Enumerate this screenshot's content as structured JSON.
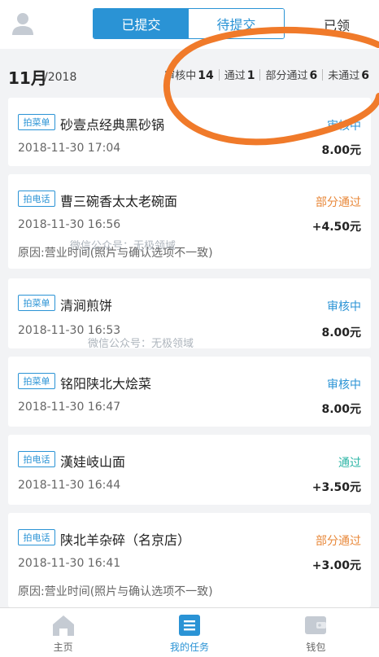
{
  "header": {
    "tabs": [
      {
        "label": "已提交",
        "active": true
      },
      {
        "label": "待提交",
        "active": false
      }
    ],
    "claimed_label": "已领"
  },
  "period": {
    "month": "11月",
    "year": "/2018"
  },
  "stats": [
    {
      "label": "审核中",
      "count": "14"
    },
    {
      "label": "通过",
      "count": "1"
    },
    {
      "label": "部分通过",
      "count": "6"
    },
    {
      "label": "未通过",
      "count": "6"
    }
  ],
  "tasks": [
    {
      "tag": "拍菜单",
      "title": "砂壹点经典黑砂锅",
      "status": "审核中",
      "time": "2018-11-30 17:04",
      "amount": "8.00元"
    },
    {
      "tag": "拍电话",
      "title": "曹三碗香太太老碗面",
      "status": "部分通过",
      "time": "2018-11-30 16:56",
      "amount": "+4.50元",
      "reason": "原因:营业时间(照片与确认选项不一致)"
    },
    {
      "tag": "拍菜单",
      "title": "清涧煎饼",
      "status": "审核中",
      "time": "2018-11-30 16:53",
      "amount": "8.00元"
    },
    {
      "tag": "拍菜单",
      "title": "铭阳陕北大烩菜",
      "status": "审核中",
      "time": "2018-11-30 16:47",
      "amount": "8.00元"
    },
    {
      "tag": "拍电话",
      "title": "漢娃岐山面",
      "status": "通过",
      "time": "2018-11-30 16:44",
      "amount": "+3.50元"
    },
    {
      "tag": "拍电话",
      "title": "陕北羊杂碎（名京店）",
      "status": "部分通过",
      "time": "2018-11-30 16:41",
      "amount": "+3.00元",
      "reason": "原因:营业时间(照片与确认选项不一致)"
    }
  ],
  "watermark": "微信公众号：无极领域",
  "nav": [
    {
      "label": "主页",
      "icon": "home-icon"
    },
    {
      "label": "我的任务",
      "icon": "task-list-icon"
    },
    {
      "label": "钱包",
      "icon": "wallet-icon"
    }
  ],
  "colors": {
    "accent": "#2a93d5",
    "status_pending": "#2a93d5",
    "status_partial": "#e8883a",
    "status_passed": "#2bb5a5",
    "annotation": "#f07a2a"
  }
}
